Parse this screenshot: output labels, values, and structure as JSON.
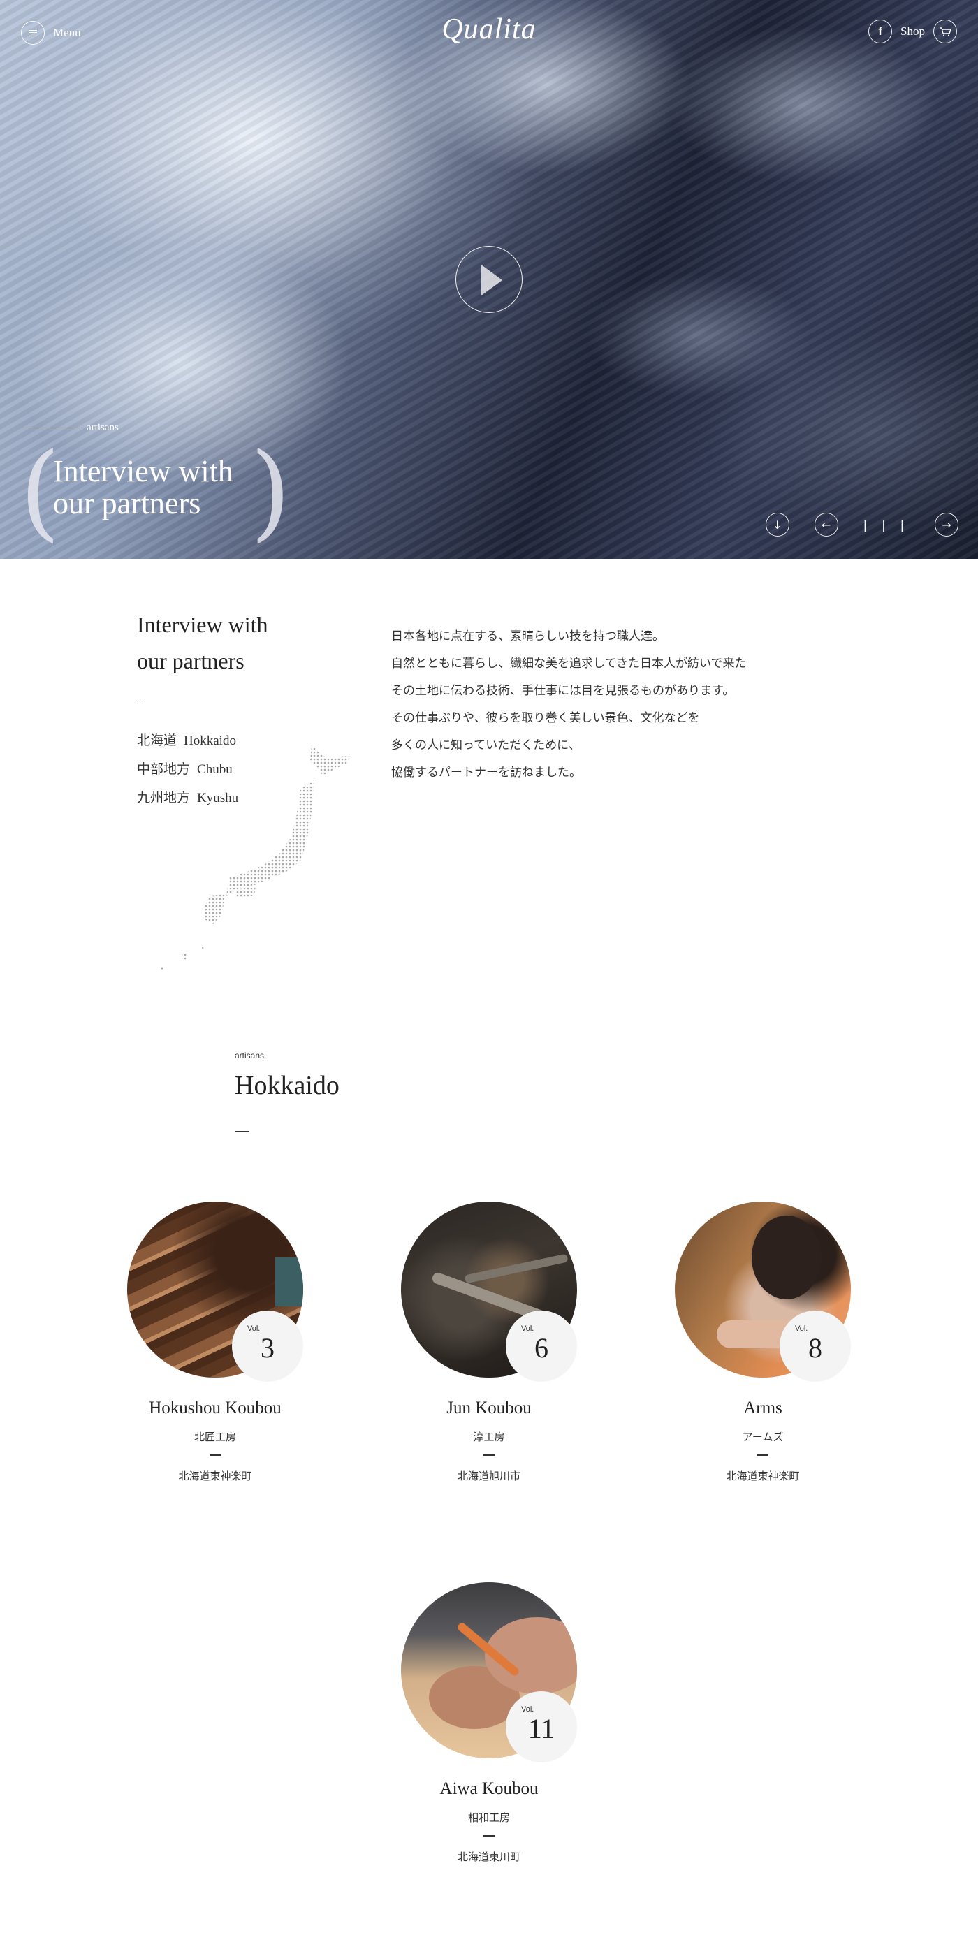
{
  "header": {
    "menu_label": "Menu",
    "logo": "Qualita",
    "shop_label": "Shop",
    "icons": [
      "menu-icon",
      "facebook-icon",
      "cart-icon"
    ]
  },
  "hero": {
    "tag": "artisans",
    "title_line1": "Interview with",
    "title_line2": "our partners",
    "pager": "| | |",
    "controls": [
      "scroll-down-icon",
      "prev-arrow-icon",
      "next-arrow-icon"
    ]
  },
  "intro": {
    "title_line1": "Interview with",
    "title_line2": "our partners",
    "regions": [
      {
        "jp": "北海道",
        "en": "Hokkaido"
      },
      {
        "jp": "中部地方",
        "en": "Chubu"
      },
      {
        "jp": "九州地方",
        "en": "Kyushu"
      }
    ],
    "paragraphs": [
      "日本各地に点在する、素晴らしい技を持つ職人達。",
      "自然とともに暮らし、繊細な美を追求してきた日本人が紡いで来た",
      "その土地に伝わる技術、手仕事には目を見張るものがあります。",
      "その仕事ぶりや、彼らを取り巻く美しい景色、文化などを",
      "多くの人に知っていただくために、",
      "協働するパートナーを訪ねました。"
    ]
  },
  "section": {
    "tag": "artisans",
    "title": "Hokkaido"
  },
  "cards": [
    {
      "vol_label": "Vol.",
      "vol": "3",
      "name": "Hokushou Koubou",
      "jp": "北匠工房",
      "location": "北海道東神楽町"
    },
    {
      "vol_label": "Vol.",
      "vol": "6",
      "name": "Jun Koubou",
      "jp": "淳工房",
      "location": "北海道旭川市"
    },
    {
      "vol_label": "Vol.",
      "vol": "8",
      "name": "Arms",
      "jp": "アームズ",
      "location": "北海道東神楽町"
    },
    {
      "vol_label": "Vol.",
      "vol": "11",
      "name": "Aiwa Koubou",
      "jp": "相和工房",
      "location": "北海道東川町"
    }
  ]
}
